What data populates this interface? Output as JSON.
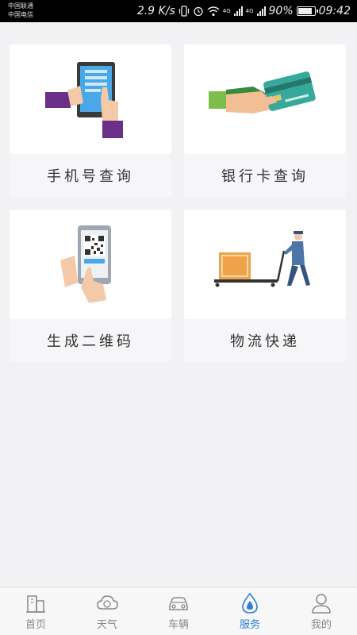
{
  "status_bar": {
    "carrier1": "中国联通",
    "carrier2": "中国电信",
    "speed": "2.9 K/s",
    "net_label": "4G",
    "battery": "90%",
    "time": "09:42"
  },
  "services": [
    {
      "label": "手机号查询",
      "icon": "phone-hand-icon"
    },
    {
      "label": "银行卡查询",
      "icon": "bank-card-icon"
    },
    {
      "label": "生成二维码",
      "icon": "qr-code-phone-icon"
    },
    {
      "label": "物流快递",
      "icon": "courier-cart-icon"
    }
  ],
  "nav": {
    "items": [
      {
        "label": "首页",
        "icon": "building-icon"
      },
      {
        "label": "天气",
        "icon": "cloud-icon"
      },
      {
        "label": "车辆",
        "icon": "car-icon"
      },
      {
        "label": "服务",
        "icon": "water-drop-icon"
      },
      {
        "label": "我的",
        "icon": "user-icon"
      }
    ],
    "active_index": 3,
    "active_color": "#2e7fd6",
    "inactive_color": "#888888"
  }
}
